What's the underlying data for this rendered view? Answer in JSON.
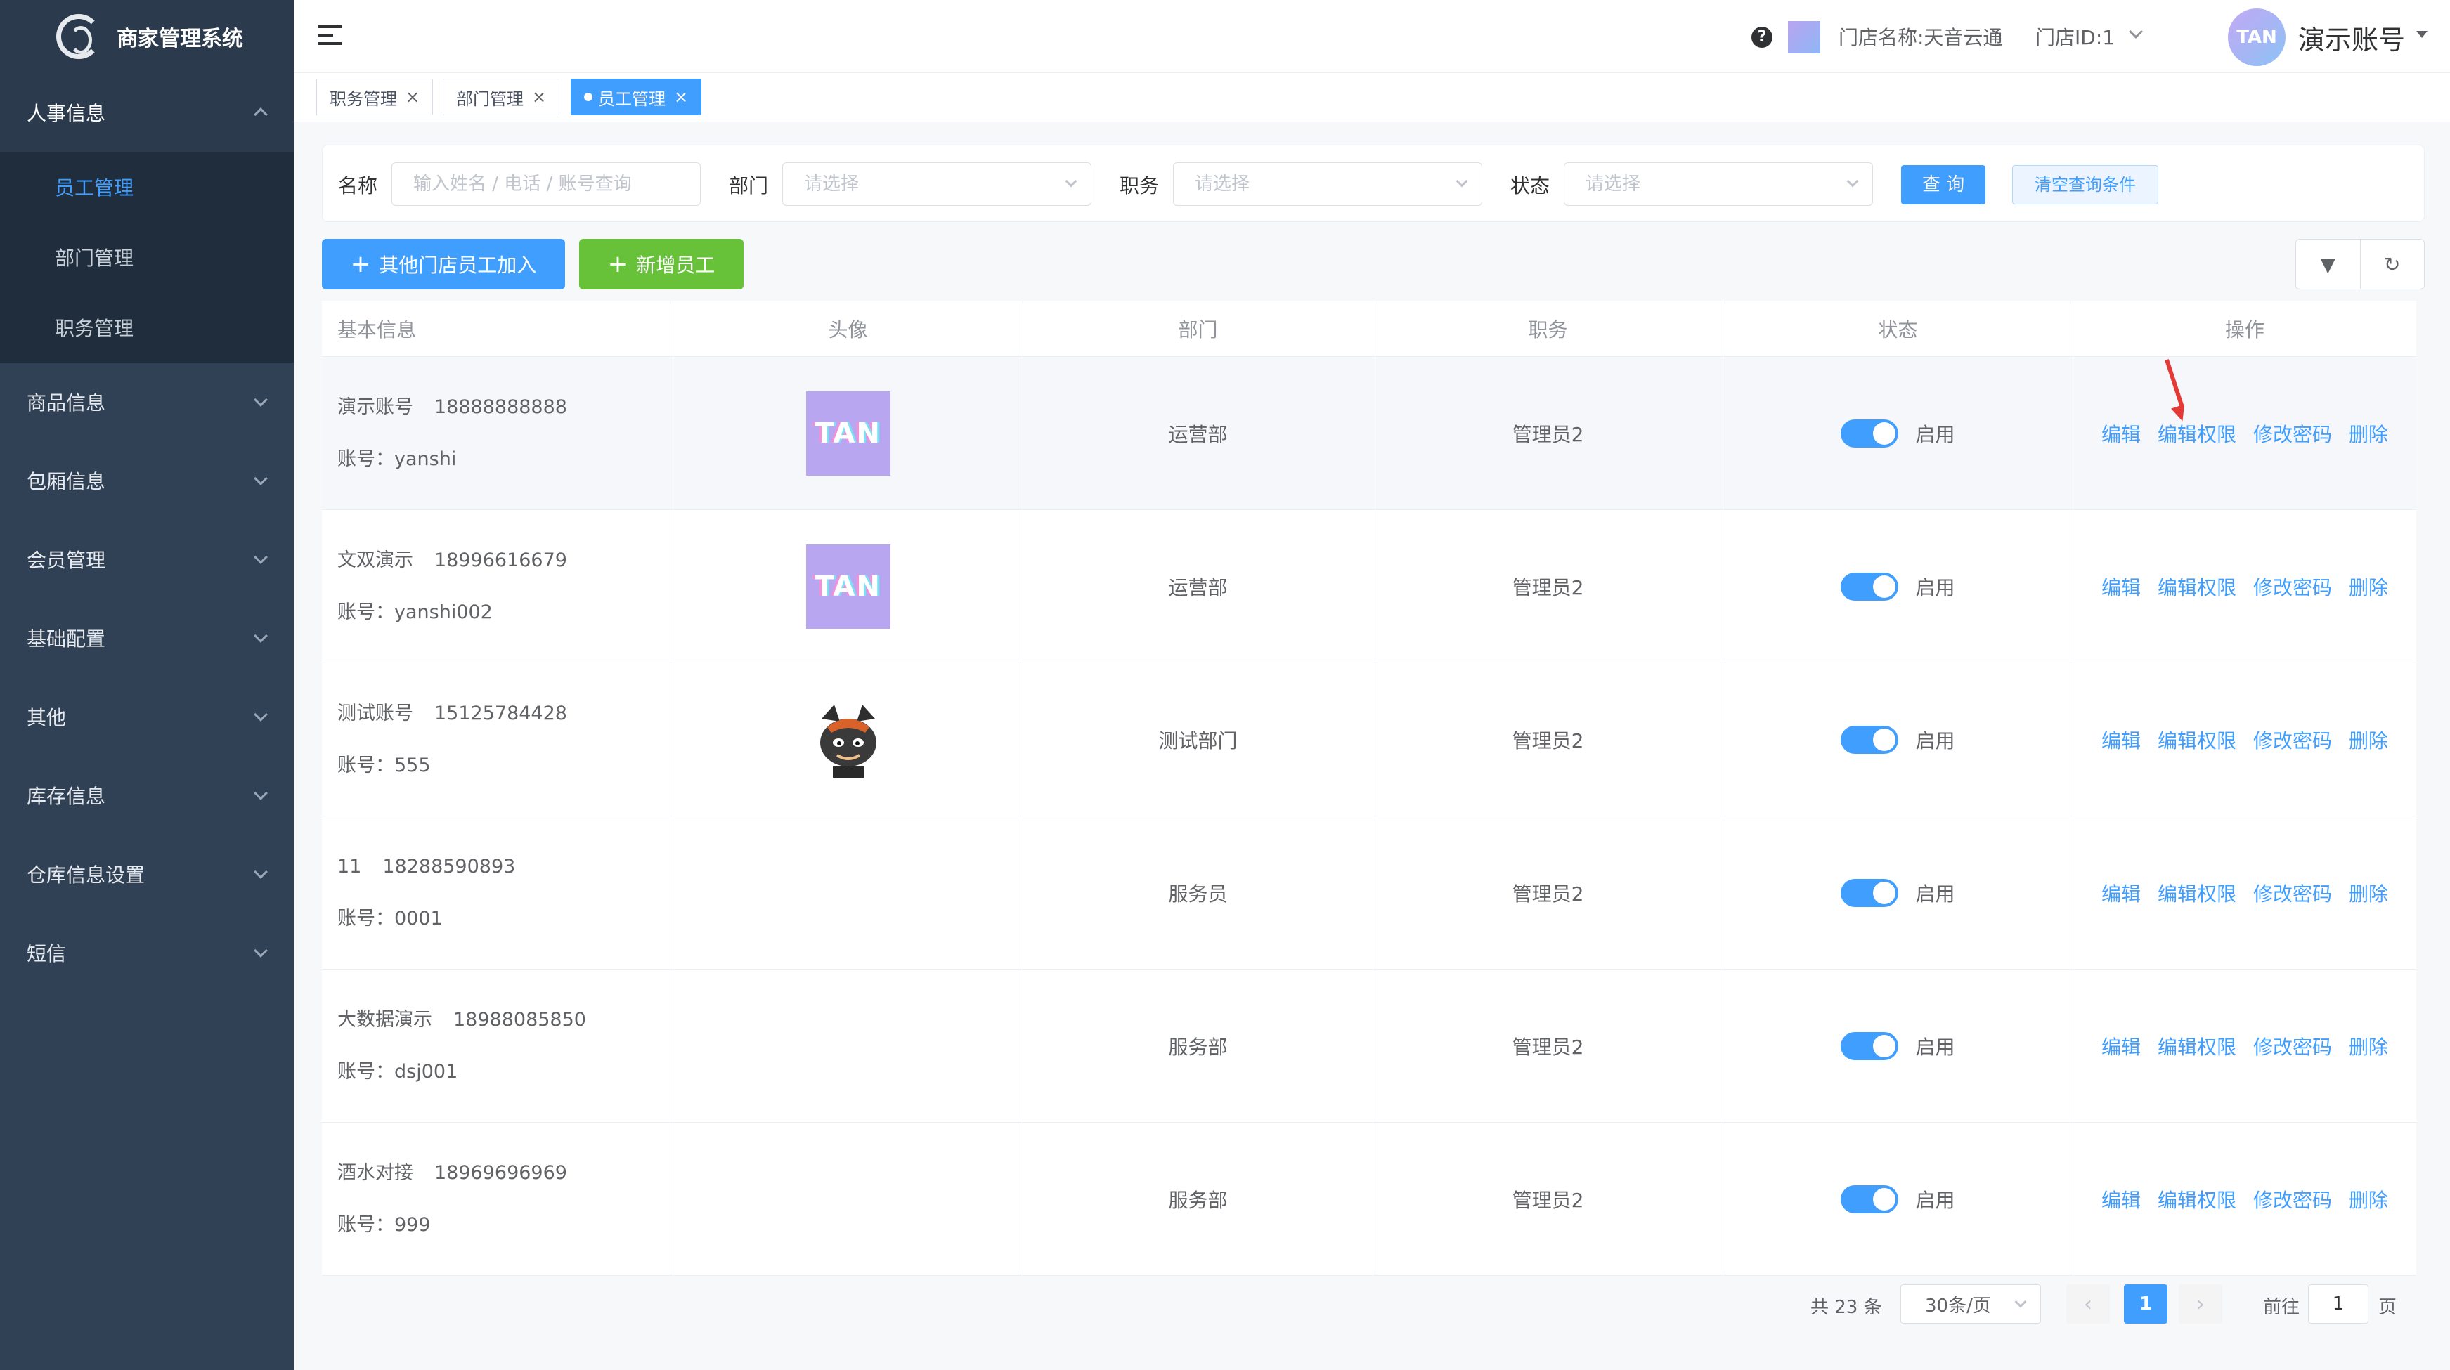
{
  "app": {
    "title": "商家管理系统"
  },
  "sidebar": {
    "groups": [
      {
        "label": "人事信息",
        "open": true,
        "items": [
          {
            "label": "员工管理",
            "active": true
          },
          {
            "label": "部门管理"
          },
          {
            "label": "职务管理"
          }
        ]
      },
      {
        "label": "商品信息"
      },
      {
        "label": "包厢信息"
      },
      {
        "label": "会员管理"
      },
      {
        "label": "基础配置"
      },
      {
        "label": "其他"
      },
      {
        "label": "库存信息"
      },
      {
        "label": "仓库信息设置"
      },
      {
        "label": "短信"
      }
    ]
  },
  "header": {
    "help_icon": "?",
    "store_name": "门店名称:天音云通",
    "store_id": "门店ID:1",
    "avatar_text": "TAN",
    "account_name": "演示账号"
  },
  "tabs": [
    {
      "label": "职务管理",
      "close": "×"
    },
    {
      "label": "部门管理",
      "close": "×"
    },
    {
      "label": "员工管理",
      "close": "×",
      "active": true
    }
  ],
  "filters": {
    "name_label": "名称",
    "name_placeholder": "输入姓名 / 电话 / 账号查询",
    "dept_label": "部门",
    "dept_placeholder": "请选择",
    "position_label": "职务",
    "position_placeholder": "请选择",
    "status_label": "状态",
    "status_placeholder": "请选择",
    "query_button": "查 询",
    "clear_button": "清空查询条件"
  },
  "actions": {
    "join_other_store": "其他门店员工加入",
    "add_employee": "新增员工",
    "plus": "+",
    "filter_icon": "▼",
    "refresh_icon": "↻"
  },
  "table": {
    "headers": [
      "基本信息",
      "头像",
      "部门",
      "职务",
      "状态",
      "操作"
    ],
    "account_prefix": "账号：",
    "status_label": "启用",
    "ops": [
      "编辑",
      "编辑权限",
      "修改密码",
      "删除"
    ],
    "rows": [
      {
        "name": "演示账号",
        "phone": "18888888888",
        "account": "yanshi",
        "avatar": "tan",
        "dept": "运营部",
        "position": "管理员2",
        "enabled": true
      },
      {
        "name": "文双演示",
        "phone": "18996616679",
        "account": "yanshi002",
        "avatar": "tan",
        "dept": "运营部",
        "position": "管理员2",
        "enabled": true
      },
      {
        "name": "测试账号",
        "phone": "15125784428",
        "account": "555",
        "avatar": "cat",
        "dept": "测试部门",
        "position": "管理员2",
        "enabled": true
      },
      {
        "name": "11",
        "phone": "18288590893",
        "account": "0001",
        "avatar": "",
        "dept": "服务员",
        "position": "管理员2",
        "enabled": true
      },
      {
        "name": "大数据演示",
        "phone": "18988085850",
        "account": "dsj001",
        "avatar": "",
        "dept": "服务部",
        "position": "管理员2",
        "enabled": true
      },
      {
        "name": "酒水对接",
        "phone": "18969696969",
        "account": "999",
        "avatar": "",
        "dept": "服务部",
        "position": "管理员2",
        "enabled": true
      }
    ]
  },
  "pagination": {
    "total": "共 23 条",
    "page_size": "30条/页",
    "prev": "‹",
    "current": "1",
    "next": "›",
    "goto_label": "前往",
    "goto_value": "1",
    "unit": "页"
  }
}
